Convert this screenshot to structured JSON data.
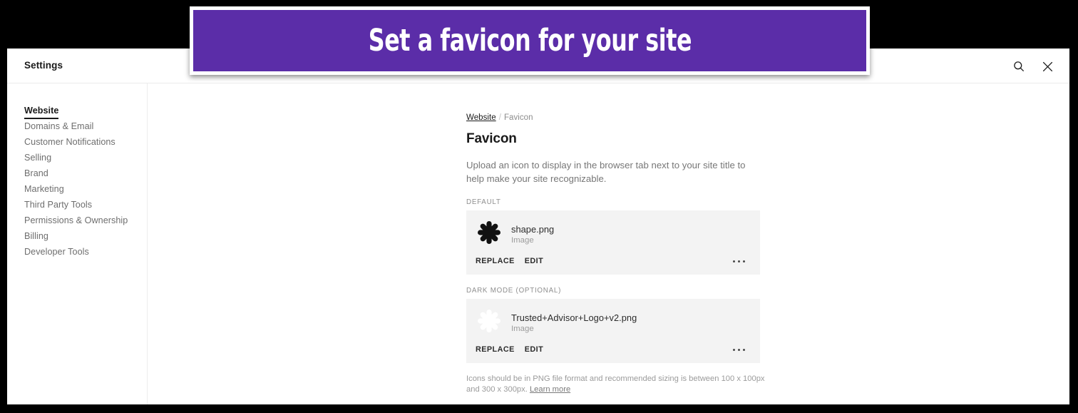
{
  "banner": {
    "text": "Set a favicon for your site",
    "background_color": "#5b2da8",
    "text_color": "#ffffff"
  },
  "header": {
    "title": "Settings",
    "search_icon": "search-icon",
    "close_icon": "close-icon"
  },
  "sidebar": {
    "items": [
      {
        "label": "Website",
        "active": true
      },
      {
        "label": "Domains & Email",
        "active": false
      },
      {
        "label": "Customer Notifications",
        "active": false
      },
      {
        "label": "Selling",
        "active": false
      },
      {
        "label": "Brand",
        "active": false
      },
      {
        "label": "Marketing",
        "active": false
      },
      {
        "label": "Third Party Tools",
        "active": false
      },
      {
        "label": "Permissions & Ownership",
        "active": false
      },
      {
        "label": "Billing",
        "active": false
      },
      {
        "label": "Developer Tools",
        "active": false
      }
    ]
  },
  "main": {
    "breadcrumb": {
      "parent": "Website",
      "separator": "/",
      "current": "Favicon"
    },
    "title": "Favicon",
    "description": "Upload an icon to display in the browser tab next to your site title to help make your site recognizable.",
    "default_section": {
      "label": "DEFAULT",
      "file_name": "shape.png",
      "file_type": "Image",
      "thumb_icon": "asterisk-flower-icon",
      "thumb_color": "#111111",
      "replace_label": "REPLACE",
      "edit_label": "EDIT",
      "more_icon": "ellipsis-icon"
    },
    "dark_mode_section": {
      "label": "DARK MODE (OPTIONAL)",
      "file_name": "Trusted+Advisor+Logo+v2.png",
      "file_type": "Image",
      "thumb_icon": "asterisk-flower-icon",
      "thumb_color": "#ffffff",
      "replace_label": "REPLACE",
      "edit_label": "EDIT",
      "more_icon": "ellipsis-icon"
    },
    "helper_text": "Icons should be in PNG file format and recommended sizing is between 100 x 100px and 300 x 300px.",
    "helper_link": "Learn more"
  }
}
